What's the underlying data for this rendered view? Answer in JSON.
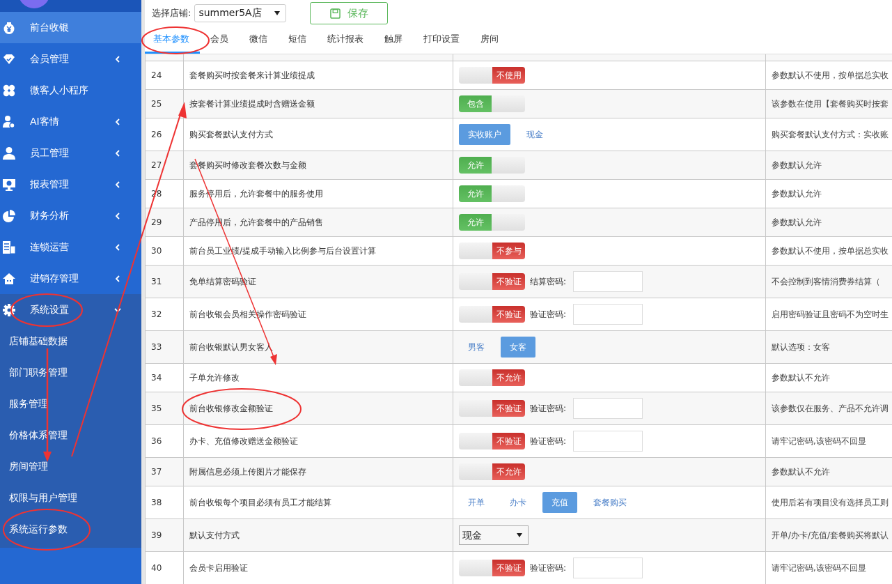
{
  "sidebar": {
    "items": [
      {
        "label": "前台收银",
        "selected": true,
        "expandable": false,
        "expanded": false
      },
      {
        "label": "会员管理",
        "selected": false,
        "expandable": true,
        "expanded": false
      },
      {
        "label": "微客人小程序",
        "selected": false,
        "expandable": false,
        "expanded": false
      },
      {
        "label": "AI客情",
        "selected": false,
        "expandable": true,
        "expanded": false
      },
      {
        "label": "员工管理",
        "selected": false,
        "expandable": true,
        "expanded": false
      },
      {
        "label": "报表管理",
        "selected": false,
        "expandable": true,
        "expanded": false
      },
      {
        "label": "财务分析",
        "selected": false,
        "expandable": true,
        "expanded": false
      },
      {
        "label": "连锁运营",
        "selected": false,
        "expandable": true,
        "expanded": false
      },
      {
        "label": "进销存管理",
        "selected": false,
        "expandable": true,
        "expanded": false
      },
      {
        "label": "系统设置",
        "selected": false,
        "expandable": true,
        "expanded": true,
        "children": [
          {
            "label": "店铺基础数据",
            "selected": false
          },
          {
            "label": "部门职务管理",
            "selected": false
          },
          {
            "label": "服务管理",
            "selected": false
          },
          {
            "label": "价格体系管理",
            "selected": false
          },
          {
            "label": "房间管理",
            "selected": false
          },
          {
            "label": "权限与用户管理",
            "selected": false
          },
          {
            "label": "系统运行参数",
            "selected": false
          }
        ]
      }
    ]
  },
  "store_selector": {
    "label": "选择店铺:",
    "value": "summer5A店"
  },
  "save_button": "保存",
  "tabs": [
    {
      "label": "基本参数",
      "selected": true
    },
    {
      "label": "会员",
      "selected": false
    },
    {
      "label": "微信",
      "selected": false
    },
    {
      "label": "短信",
      "selected": false
    },
    {
      "label": "统计报表",
      "selected": false
    },
    {
      "label": "触屏",
      "selected": false
    },
    {
      "label": "打印设置",
      "selected": false
    },
    {
      "label": "房间",
      "selected": false
    }
  ],
  "table": {
    "rows": [
      {
        "no": "24",
        "name": "套餐购买时按套餐来计算业绩提成",
        "control": {
          "kind": "toggle",
          "on": false,
          "label": "不使用"
        },
        "description": "参数默认不使用，按单据总实收"
      },
      {
        "no": "25",
        "name": "按套餐计算业绩提成时含赠送金额",
        "control": {
          "kind": "toggle",
          "on": true,
          "label": "包含"
        },
        "description": "该参数在使用【套餐购买时按套"
      },
      {
        "no": "26",
        "name": "购买套餐默认支付方式",
        "control": {
          "kind": "choice",
          "options": [
            {
              "label": "实收账户",
              "selected": true
            },
            {
              "label": "现金",
              "selected": false
            }
          ]
        },
        "description": "购买套餐默认支付方式：实收账"
      },
      {
        "no": "27",
        "name": "套餐购买时修改套餐次数与金额",
        "control": {
          "kind": "toggle",
          "on": true,
          "label": "允许"
        },
        "description": "参数默认允许"
      },
      {
        "no": "28",
        "name": "服务停用后，允许套餐中的服务使用",
        "control": {
          "kind": "toggle",
          "on": true,
          "label": "允许"
        },
        "description": "参数默认允许"
      },
      {
        "no": "29",
        "name": "产品停用后，允许套餐中的产品销售",
        "control": {
          "kind": "toggle",
          "on": true,
          "label": "允许"
        },
        "description": "参数默认允许"
      },
      {
        "no": "30",
        "name": "前台员工业绩/提成手动输入比例参与后台设置计算",
        "control": {
          "kind": "toggle",
          "on": false,
          "label": "不参与"
        },
        "description": "参数默认不使用，按单据总实收"
      },
      {
        "no": "31",
        "name": "免单结算密码验证",
        "control": {
          "kind": "toggle_password",
          "on": false,
          "label": "不验证",
          "field_label": "结算密码:"
        },
        "description": "不会控制到客情消费券结算（"
      },
      {
        "no": "32",
        "name": "前台收银会员相关操作密码验证",
        "control": {
          "kind": "toggle_password",
          "on": false,
          "label": "不验证",
          "field_label": "验证密码:"
        },
        "description": "启用密码验证且密码不为空时生"
      },
      {
        "no": "33",
        "name": "前台收银默认男女客人",
        "control": {
          "kind": "choice",
          "options": [
            {
              "label": "男客",
              "selected": false
            },
            {
              "label": "女客",
              "selected": true
            }
          ]
        },
        "description": "默认选项：女客"
      },
      {
        "no": "34",
        "name": "子单允许修改",
        "control": {
          "kind": "toggle",
          "on": false,
          "label": "不允许"
        },
        "description": "参数默认不允许"
      },
      {
        "no": "35",
        "name": "前台收银修改金额验证",
        "control": {
          "kind": "toggle_password",
          "on": false,
          "label": "不验证",
          "field_label": "验证密码:"
        },
        "description": "该参数仅在服务、产品不允许调"
      },
      {
        "no": "36",
        "name": "办卡、充值修改赠送金额验证",
        "control": {
          "kind": "toggle_password",
          "on": false,
          "label": "不验证",
          "field_label": "验证密码:"
        },
        "description": "请牢记密码,该密码不回显"
      },
      {
        "no": "37",
        "name": "附属信息必须上传图片才能保存",
        "control": {
          "kind": "toggle",
          "on": false,
          "label": "不允许"
        },
        "description": "参数默认不允许"
      },
      {
        "no": "38",
        "name": "前台收银每个项目必须有员工才能结算",
        "control": {
          "kind": "choice",
          "options": [
            {
              "label": "开单",
              "selected": false
            },
            {
              "label": "办卡",
              "selected": false
            },
            {
              "label": "充值",
              "selected": true
            },
            {
              "label": "套餐购买",
              "selected": false
            }
          ]
        },
        "description": "使用后若有项目没有选择员工则"
      },
      {
        "no": "39",
        "name": "默认支付方式",
        "control": {
          "kind": "select",
          "value": "现金"
        },
        "description": "开单/办卡/充值/套餐购买将默认"
      },
      {
        "no": "40",
        "name": "会员卡启用验证",
        "control": {
          "kind": "toggle_password",
          "on": false,
          "label": "不验证",
          "field_label": "验证密码:"
        },
        "description": "请牢记密码,该密码不回显"
      }
    ]
  }
}
